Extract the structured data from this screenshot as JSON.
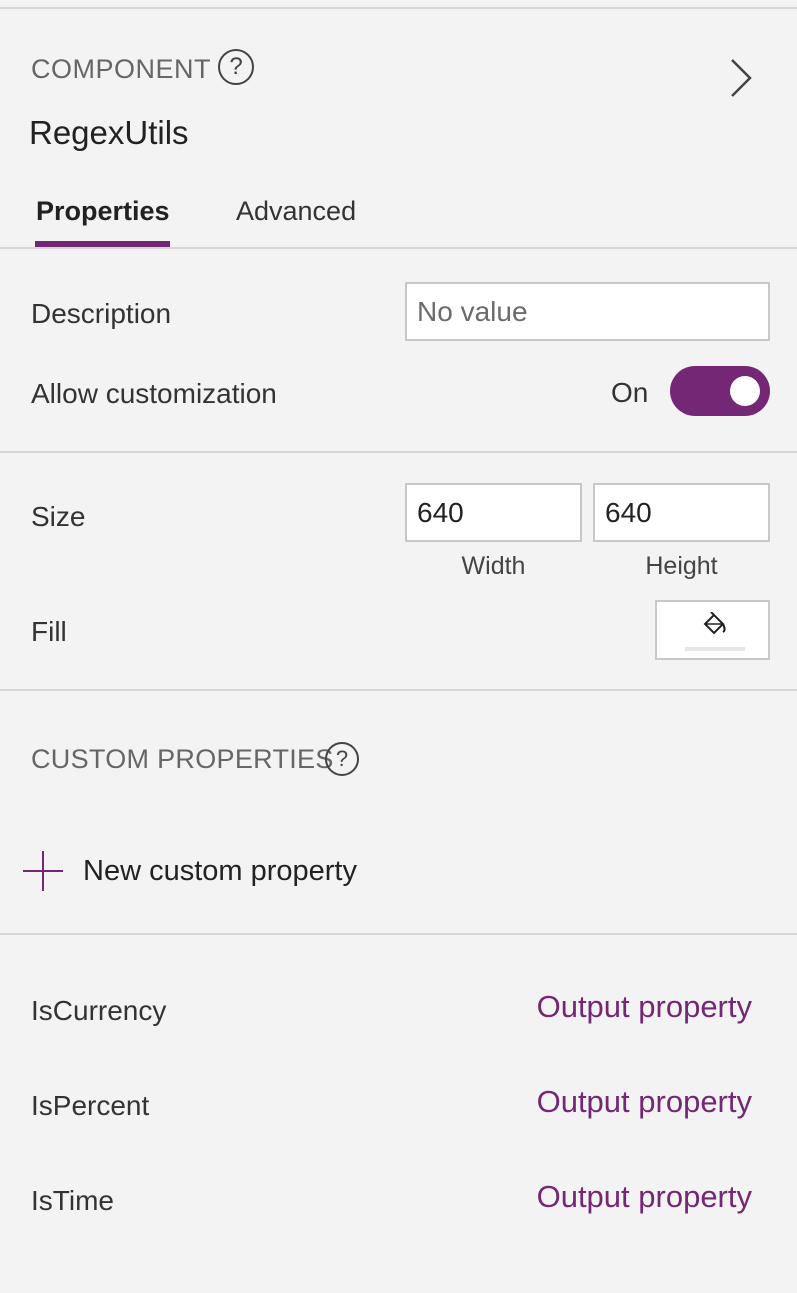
{
  "header": {
    "section_label": "COMPONENT",
    "component_name": "RegexUtils",
    "help_glyph": "?",
    "icons": {
      "help": "help-circle-icon",
      "expand": "chevron-right-icon"
    }
  },
  "tabs": [
    {
      "label": "Properties",
      "active": true
    },
    {
      "label": "Advanced",
      "active": false
    }
  ],
  "general": {
    "description_label": "Description",
    "description_value": "",
    "description_placeholder": "No value",
    "allow_customization_label": "Allow customization",
    "allow_customization_state": "On"
  },
  "layout": {
    "size_label": "Size",
    "width_value": "640",
    "height_value": "640",
    "width_caption": "Width",
    "height_caption": "Height",
    "fill_label": "Fill",
    "fill_icon": "paint-bucket-icon"
  },
  "custom_properties": {
    "section_label": "CUSTOM PROPERTIES",
    "new_label": "New custom property",
    "items": [
      {
        "name": "IsCurrency",
        "type": "Output property"
      },
      {
        "name": "IsPercent",
        "type": "Output property"
      },
      {
        "name": "IsTime",
        "type": "Output property"
      }
    ]
  },
  "colors": {
    "accent": "#742774",
    "background": "#f3f3f3",
    "divider": "#d6d6d6"
  }
}
